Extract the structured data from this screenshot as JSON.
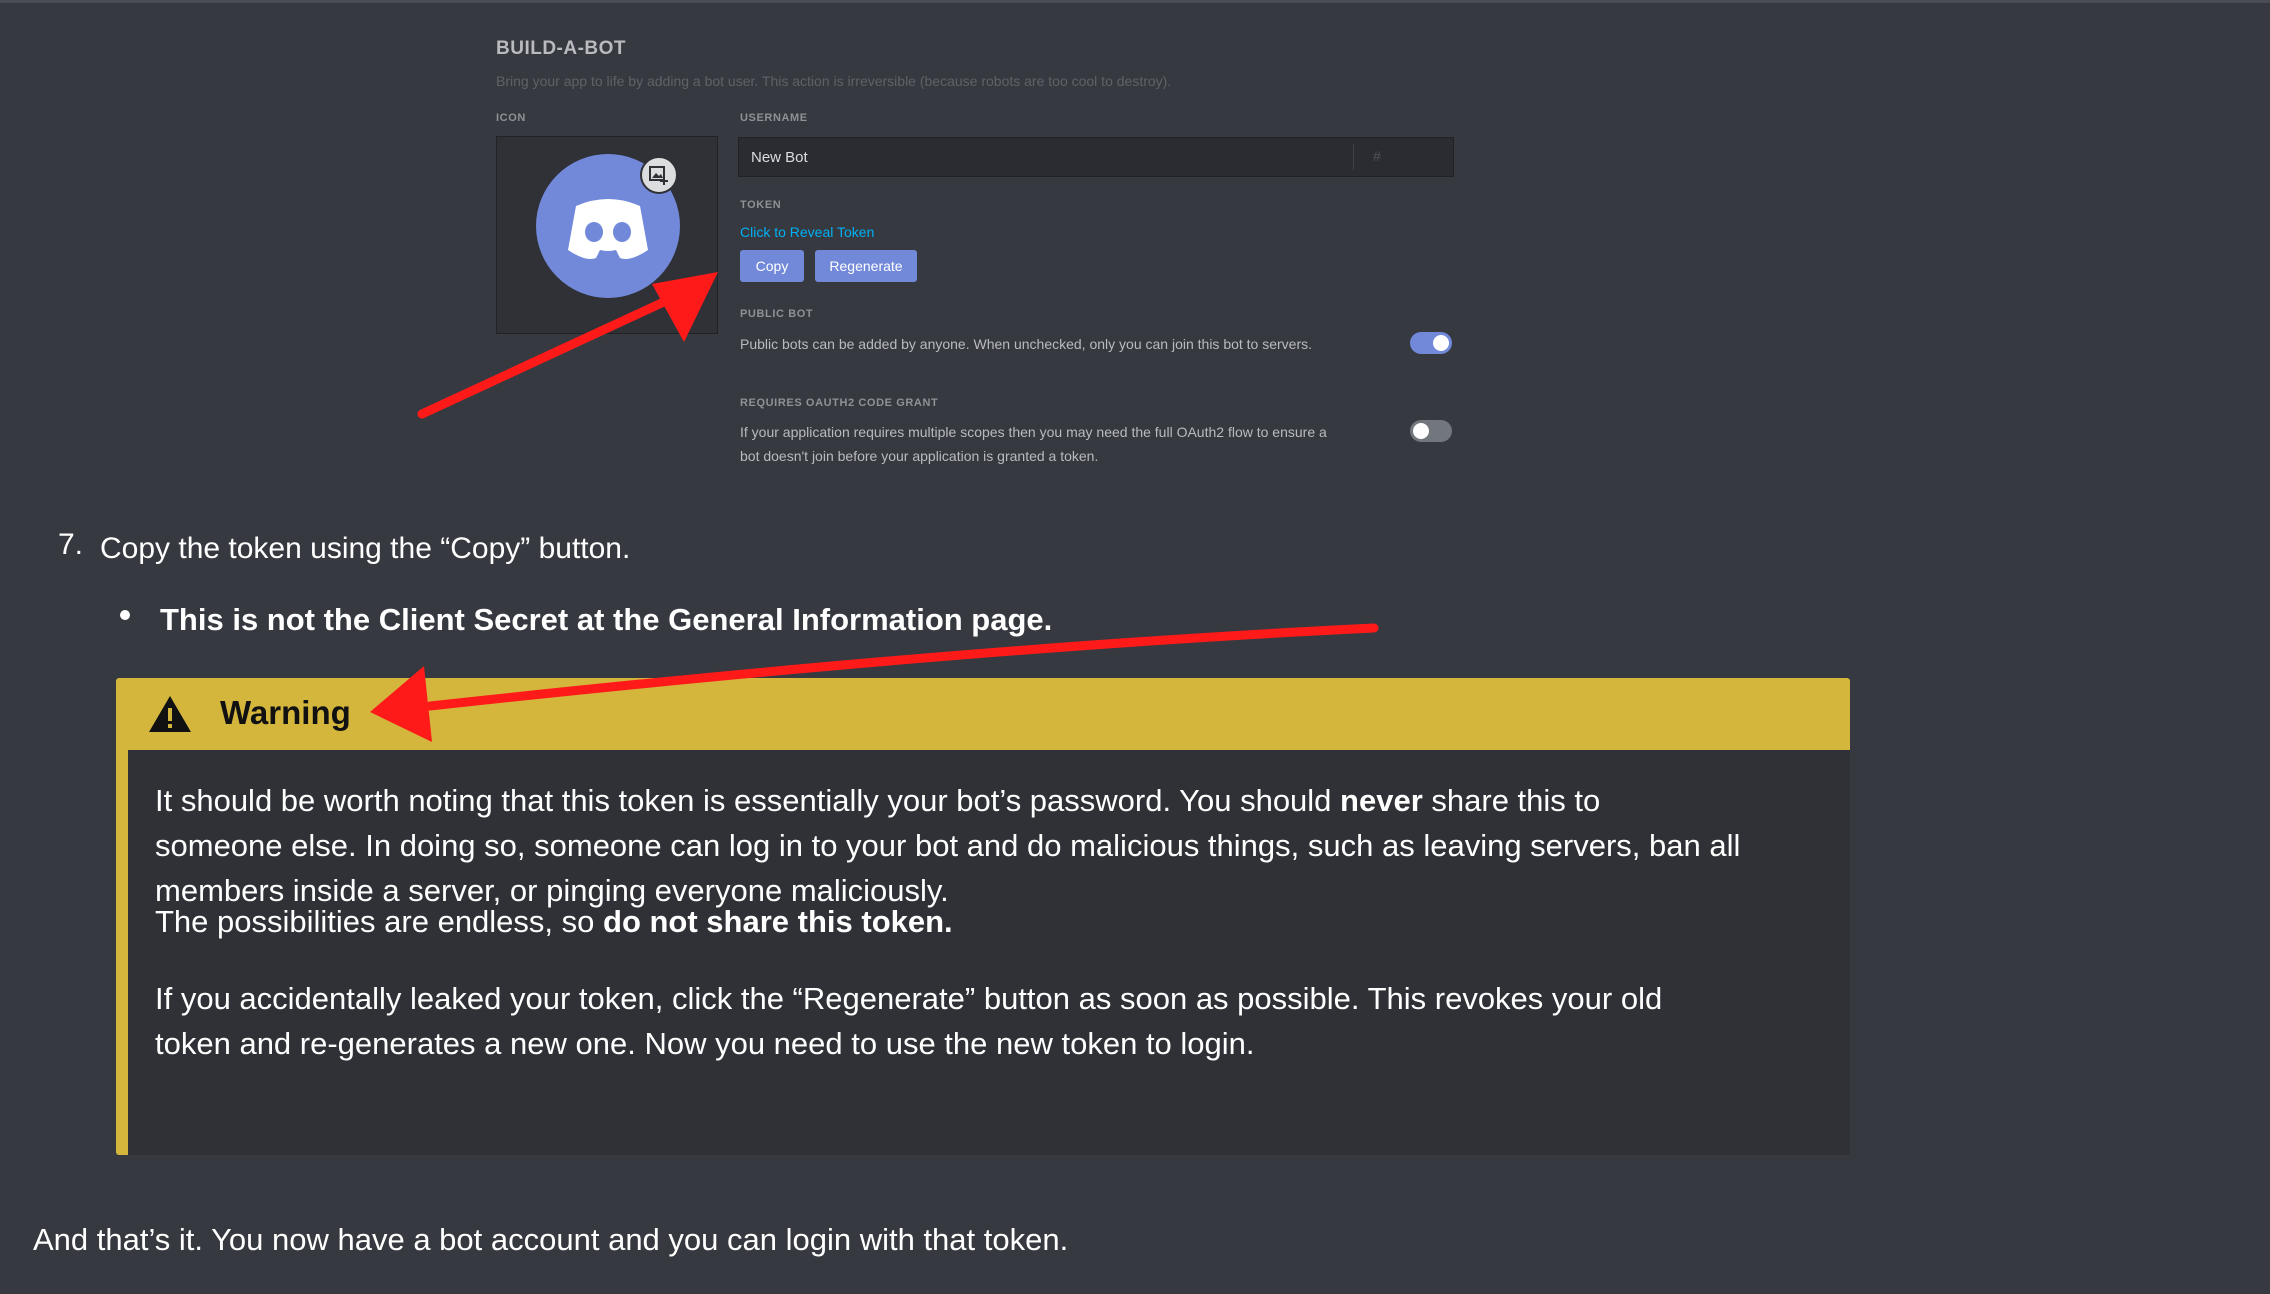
{
  "screenshot": {
    "title": "BUILD-A-BOT",
    "description": "Bring your app to life by adding a bot user. This action is irreversible (because robots are too cool to destroy).",
    "icon_label": "ICON",
    "username_label": "USERNAME",
    "username_value": "New Bot",
    "discriminator_symbol": "#",
    "token_label": "TOKEN",
    "reveal_link": "Click to Reveal Token",
    "copy_button": "Copy",
    "regenerate_button": "Regenerate",
    "public_bot_label": "PUBLIC BOT",
    "public_bot_desc": "Public bots can be added by anyone. When unchecked, only you can join this bot to servers.",
    "public_bot_enabled": true,
    "oauth_label": "REQUIRES OAUTH2 CODE GRANT",
    "oauth_desc_1": "If your application requires multiple scopes then you may need the full OAuth2 flow to ensure a",
    "oauth_desc_2": "bot doesn't join before your application is granted a token.",
    "oauth_enabled": false
  },
  "article": {
    "step_number": "7.",
    "step_text": "Copy the token using the “Copy” button.",
    "bullet_text": "This is not the Client Secret at the General Information page.",
    "warning": {
      "title": "Warning",
      "p1_a": "It should be worth noting that this token is essentially your bot’s password. You should ",
      "p1_bold": "never",
      "p1_b": " share this to",
      "p1_line2": "someone else. In doing so, someone can log in to your bot and do malicious things, such as leaving servers, ban all",
      "p1_line3": "members inside a server, or pinging everyone maliciously.",
      "p2_a": "The possibilities are endless, so ",
      "p2_bold": "do not share this token.",
      "p3_line1": "If you accidentally leaked your token, click the “Regenerate” button as soon as possible. This revokes your old",
      "p3_line2": "token and re-generates a new one. Now you need to use the new token to login."
    },
    "final_text": "And that’s it. You now have a bot account and you can login with that token."
  },
  "colors": {
    "background": "#36393f",
    "blurple": "#7289da",
    "warning_yellow": "#d4b63c",
    "arrow_red": "#ff1a1a"
  }
}
